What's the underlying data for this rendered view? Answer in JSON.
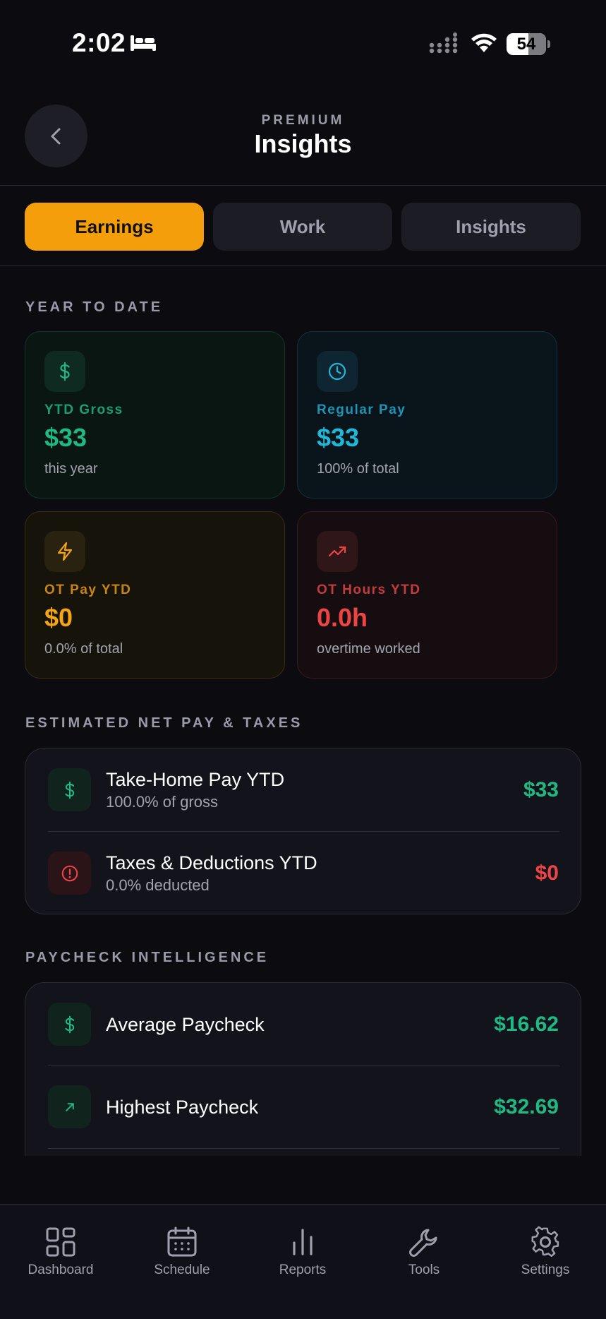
{
  "status_bar": {
    "time": "2:02",
    "battery": "54"
  },
  "header": {
    "eyebrow": "PREMIUM",
    "title": "Insights"
  },
  "tabs": [
    {
      "label": "Earnings",
      "active": true
    },
    {
      "label": "Work",
      "active": false
    },
    {
      "label": "Insights",
      "active": false
    }
  ],
  "year_to_date": {
    "section_label": "YEAR TO DATE",
    "cards": [
      {
        "icon": "dollar-icon",
        "label": "YTD Gross",
        "value": "$33",
        "sub": "this year",
        "color": "#1fba84"
      },
      {
        "icon": "clock-icon",
        "label": "Regular Pay",
        "value": "$33",
        "sub": "100% of total",
        "color": "#20b8d9"
      },
      {
        "icon": "lightning-icon",
        "label": "OT Pay YTD",
        "value": "$0",
        "sub": "0.0% of total",
        "color": "#f5a414"
      },
      {
        "icon": "trending-up-icon",
        "label": "OT Hours YTD",
        "value": "0.0h",
        "sub": "overtime worked",
        "color": "#ef4444"
      }
    ]
  },
  "net_pay": {
    "section_label": "ESTIMATED NET PAY & TAXES",
    "rows": [
      {
        "icon": "dollar-icon",
        "title": "Take-Home Pay YTD",
        "sub": "100.0% of gross",
        "value": "$33"
      },
      {
        "icon": "alert-circle-icon",
        "title": "Taxes & Deductions YTD",
        "sub": "0.0% deducted",
        "value": "$0"
      }
    ]
  },
  "paycheck_intelligence": {
    "section_label": "PAYCHECK INTELLIGENCE",
    "rows": [
      {
        "icon": "dollar-icon",
        "title": "Average Paycheck",
        "value": "$16.62"
      },
      {
        "icon": "arrow-up-right-icon",
        "title": "Highest Paycheck",
        "value": "$32.69"
      }
    ]
  },
  "bottom_nav": [
    {
      "icon": "dashboard-icon",
      "label": "Dashboard"
    },
    {
      "icon": "calendar-icon",
      "label": "Schedule"
    },
    {
      "icon": "bar-chart-icon",
      "label": "Reports"
    },
    {
      "icon": "wrench-icon",
      "label": "Tools"
    },
    {
      "icon": "gear-icon",
      "label": "Settings"
    }
  ],
  "colors": {
    "accent": "#f59e0b",
    "green": "#1fba84",
    "cyan": "#20b8d9",
    "red": "#ef4444",
    "background": "#0b0b10"
  }
}
